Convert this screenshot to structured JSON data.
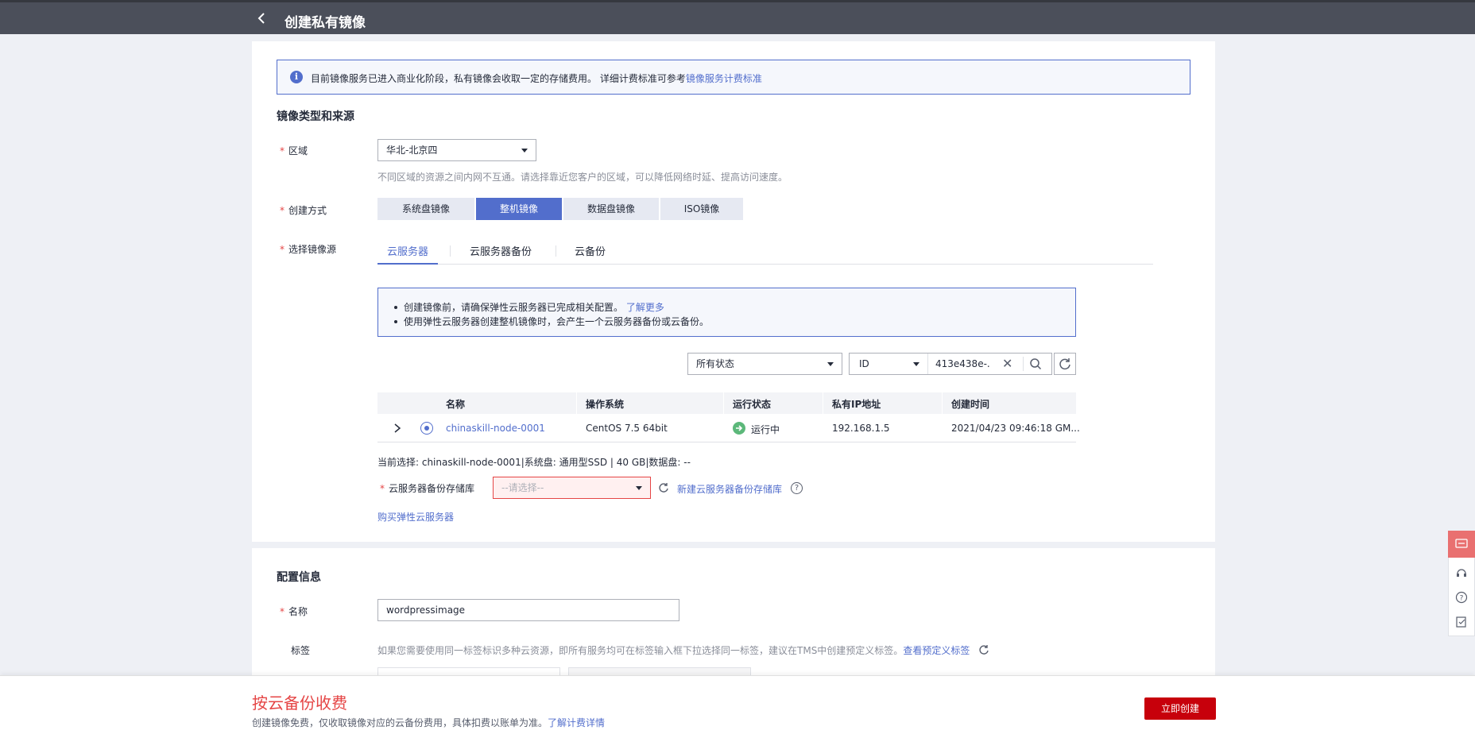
{
  "header": {
    "title": "创建私有镜像"
  },
  "alert": {
    "text": "目前镜像服务已进入商业化阶段，私有镜像会收取一定的存储费用。 详细计费标准可参考",
    "link": "镜像服务计费标准"
  },
  "section1": {
    "title": "镜像类型和来源"
  },
  "region": {
    "label": "区域",
    "value": "华北-北京四",
    "hint": "不同区域的资源之间内网不互通。请选择靠近您客户的区域，可以降低网络时延、提高访问速度。"
  },
  "create_method": {
    "label": "创建方式",
    "options": [
      "系统盘镜像",
      "整机镜像",
      "数据盘镜像",
      "ISO镜像"
    ],
    "selected": "整机镜像"
  },
  "source": {
    "label": "选择镜像源",
    "tabs": [
      "云服务器",
      "云服务器备份",
      "云备份"
    ],
    "active_tab": "云服务器"
  },
  "notice": {
    "line1": "创建镜像前，请确保弹性云服务器已完成相关配置。",
    "line1_link": "了解更多",
    "line2": "使用弹性云服务器创建整机镜像时，会产生一个云服务器备份或云备份。"
  },
  "filter": {
    "status": "所有状态",
    "field": "ID",
    "value": "413e438e-..."
  },
  "table": {
    "headers": [
      "名称",
      "操作系统",
      "运行状态",
      "私有IP地址",
      "创建时间"
    ],
    "rows": [
      {
        "name": "chinaskill-node-0001",
        "os": "CentOS 7.5 64bit",
        "status": "运行中",
        "ip": "192.168.1.5",
        "created": "2021/04/23 09:46:18 GM..."
      }
    ]
  },
  "current_selection": "当前选择: chinaskill-node-0001|系统盘: 通用型SSD | 40 GB|数据盘: --",
  "backup_repo": {
    "label": "云服务器备份存储库",
    "placeholder": "--请选择--",
    "new_link": "新建云服务器备份存储库"
  },
  "buy_link": "购买弹性云服务器",
  "section2": {
    "title": "配置信息"
  },
  "name_field": {
    "label": "名称",
    "value": "wordpressimage"
  },
  "tags": {
    "label": "标签",
    "hint": "如果您需要使用同一标签标识多种云资源，即所有服务均可在标签输入框下拉选择同一标签，建议在TMS中创建预定义标签。",
    "link": "查看预定义标签"
  },
  "footer": {
    "price_title": "按云备份收费",
    "note": "创建镜像免费，仅收取镜像对应的云备份费用，具体扣费以账单为准。",
    "note_link": "了解计费详情",
    "create_button": "立即创建"
  },
  "colors": {
    "primary": "#526ecc",
    "danger": "#c7000b",
    "running": "#5cb87a",
    "header_bg": "#4b4f5a"
  }
}
